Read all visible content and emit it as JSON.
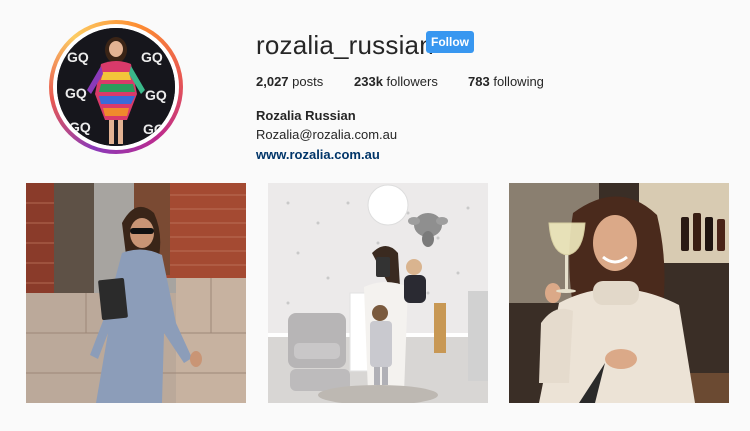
{
  "profile": {
    "username": "rozalia_russian",
    "follow_label": "Follow",
    "full_name": "Rozalia Russian",
    "email": "Rozalia@rozalia.com.au",
    "website": "www.rozalia.com.au"
  },
  "stats": {
    "posts_count": "2,027",
    "posts_label": "posts",
    "followers_count": "233k",
    "followers_label": "followers",
    "following_count": "783",
    "following_label": "following"
  },
  "avatar_backdrop_text": [
    "GQ",
    "GQ",
    "GQ",
    "GQ",
    "GQ",
    "GQ"
  ],
  "colors": {
    "follow_button": "#3897f0",
    "link": "#003569",
    "background": "#fafafa"
  },
  "posts": [
    {
      "subject": "woman in blue dress against brick wall"
    },
    {
      "subject": "mirror selfie in nursery with children"
    },
    {
      "subject": "woman in cream sweater holding wine glass"
    }
  ]
}
